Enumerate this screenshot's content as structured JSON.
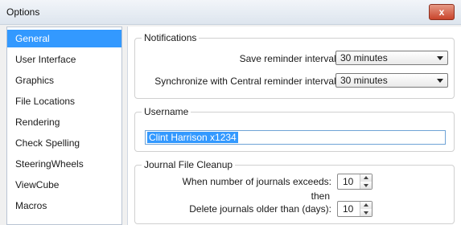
{
  "window": {
    "title": "Options",
    "close_label": "x"
  },
  "sidebar": {
    "items": [
      {
        "label": "General",
        "selected": true
      },
      {
        "label": "User Interface"
      },
      {
        "label": "Graphics"
      },
      {
        "label": "File Locations"
      },
      {
        "label": "Rendering"
      },
      {
        "label": "Check Spelling"
      },
      {
        "label": "SteeringWheels"
      },
      {
        "label": "ViewCube"
      },
      {
        "label": "Macros"
      }
    ]
  },
  "notifications": {
    "title": "Notifications",
    "save_reminder_label": "Save reminder interval:",
    "save_reminder_value": "30 minutes",
    "sync_reminder_label": "Synchronize with Central reminder interval:",
    "sync_reminder_value": "30 minutes"
  },
  "username": {
    "title": "Username",
    "value": "Clint Harrison x1234"
  },
  "journal": {
    "title": "Journal File Cleanup",
    "exceeds_label": "When number of journals exceeds:",
    "exceeds_value": "10",
    "then_label": "then",
    "delete_label": "Delete journals older than (days):",
    "delete_value": "10"
  },
  "colors": {
    "selection": "#3399ff",
    "close_button": "#c9442b"
  }
}
